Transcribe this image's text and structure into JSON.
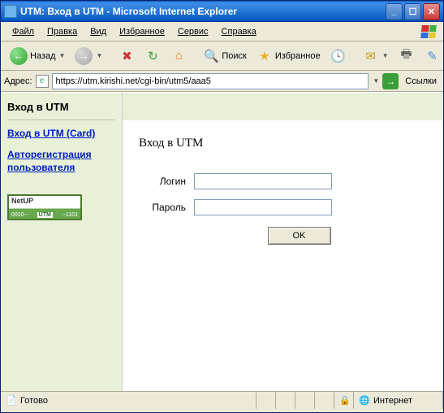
{
  "window": {
    "title": "UTM: Вход в UTM - Microsoft Internet Explorer"
  },
  "menu": {
    "file": "Файл",
    "edit": "Правка",
    "view": "Вид",
    "favorites": "Избранное",
    "tools": "Сервис",
    "help": "Справка"
  },
  "toolbar": {
    "back": "Назад",
    "search": "Поиск",
    "favorites": "Избранное"
  },
  "addressbar": {
    "label": "Адрес:",
    "url": "https://utm.kirishi.net/cgi-bin/utm5/aaa5",
    "links": "Ссылки"
  },
  "sidebar": {
    "header": "Вход в UTM",
    "link1": "Вход в UTM (Card)",
    "link2": "Авторегистрация пользователя",
    "badge": {
      "brand": "NetUP",
      "left": "0010--",
      "mid": "UTM",
      "right": "--1101"
    }
  },
  "page": {
    "heading": "Вход в UTM",
    "login_label": "Логин",
    "password_label": "Пароль",
    "submit": "OK",
    "login_value": "",
    "password_value": ""
  },
  "status": {
    "text": "Готово",
    "zone": "Интернет"
  }
}
